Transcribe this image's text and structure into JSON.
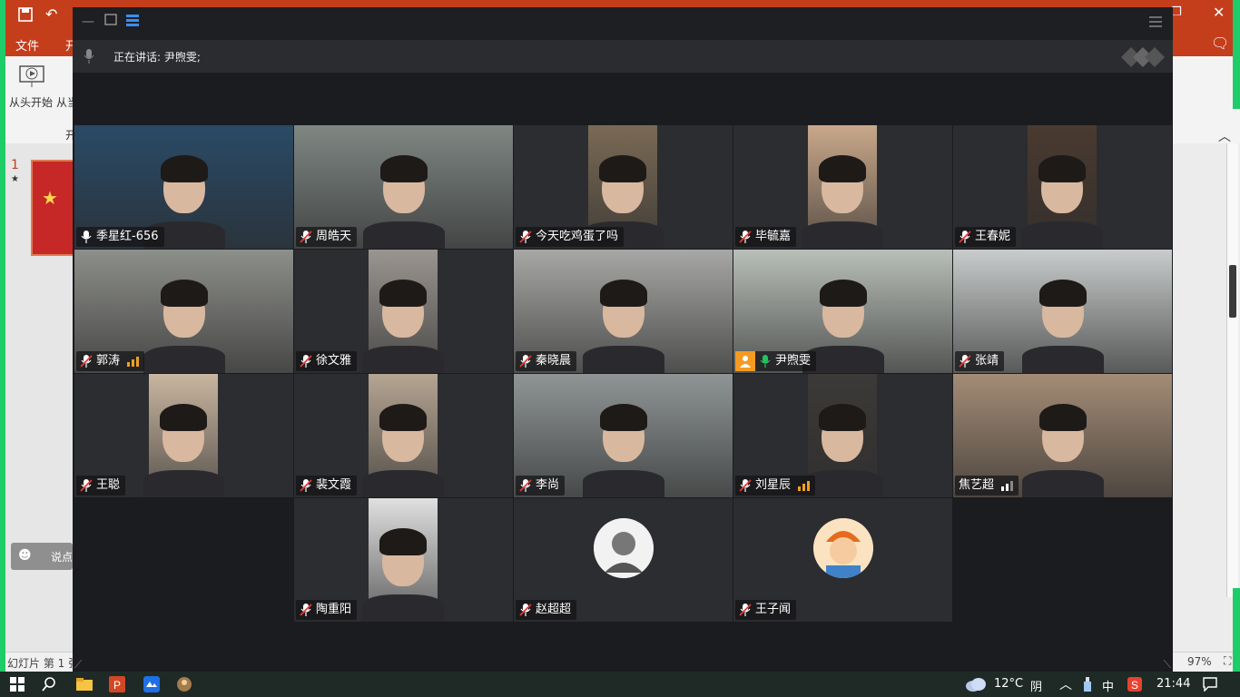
{
  "powerpoint": {
    "menu_file": "文件",
    "menu_next": "开",
    "ribbon_start_from_beginning": "从头开始",
    "ribbon_from_current": "从当",
    "ribbon_group": "开",
    "slide_number": "1",
    "slide_star": "★",
    "comment_placeholder": "说点",
    "status_slide": "幻灯片 第 1 张",
    "zoom": "97%",
    "accent_color": "#c43e1c"
  },
  "meeting": {
    "current_speaker_label": "正在讲话: 尹煦雯;",
    "highlight_color": "#22c35e",
    "participants": [
      {
        "name": "季星红-656",
        "mic": "on",
        "signal": null
      },
      {
        "name": "周皓天",
        "mic": "muted",
        "signal": null
      },
      {
        "name": "今天吃鸡蛋了吗",
        "mic": "muted",
        "signal": null
      },
      {
        "name": "毕毓嘉",
        "mic": "muted",
        "signal": null
      },
      {
        "name": "王春妮",
        "mic": "muted",
        "signal": null
      },
      {
        "name": "郭涛",
        "mic": "muted",
        "signal": "orange"
      },
      {
        "name": "徐文雅",
        "mic": "muted",
        "signal": null
      },
      {
        "name": "秦晓晨",
        "mic": "muted",
        "signal": null
      },
      {
        "name": "尹煦雯",
        "mic": "active",
        "signal": null,
        "host": true
      },
      {
        "name": "张靖",
        "mic": "muted",
        "signal": null
      },
      {
        "name": "王聪",
        "mic": "muted",
        "signal": null
      },
      {
        "name": "裴文霞",
        "mic": "muted",
        "signal": null
      },
      {
        "name": "李尚",
        "mic": "muted",
        "signal": null
      },
      {
        "name": "刘星辰",
        "mic": "muted",
        "signal": "orange"
      },
      {
        "name": "焦艺超",
        "mic": "none",
        "signal": "white"
      },
      {
        "name": "陶重阳",
        "mic": "muted",
        "signal": null
      },
      {
        "name": "赵超超",
        "mic": "muted",
        "signal": null
      },
      {
        "name": "王子闻",
        "mic": "muted",
        "signal": null
      }
    ]
  },
  "taskbar": {
    "weather_temp": "12°C",
    "weather_desc": "阴",
    "ime": "中",
    "time": "21:44"
  }
}
